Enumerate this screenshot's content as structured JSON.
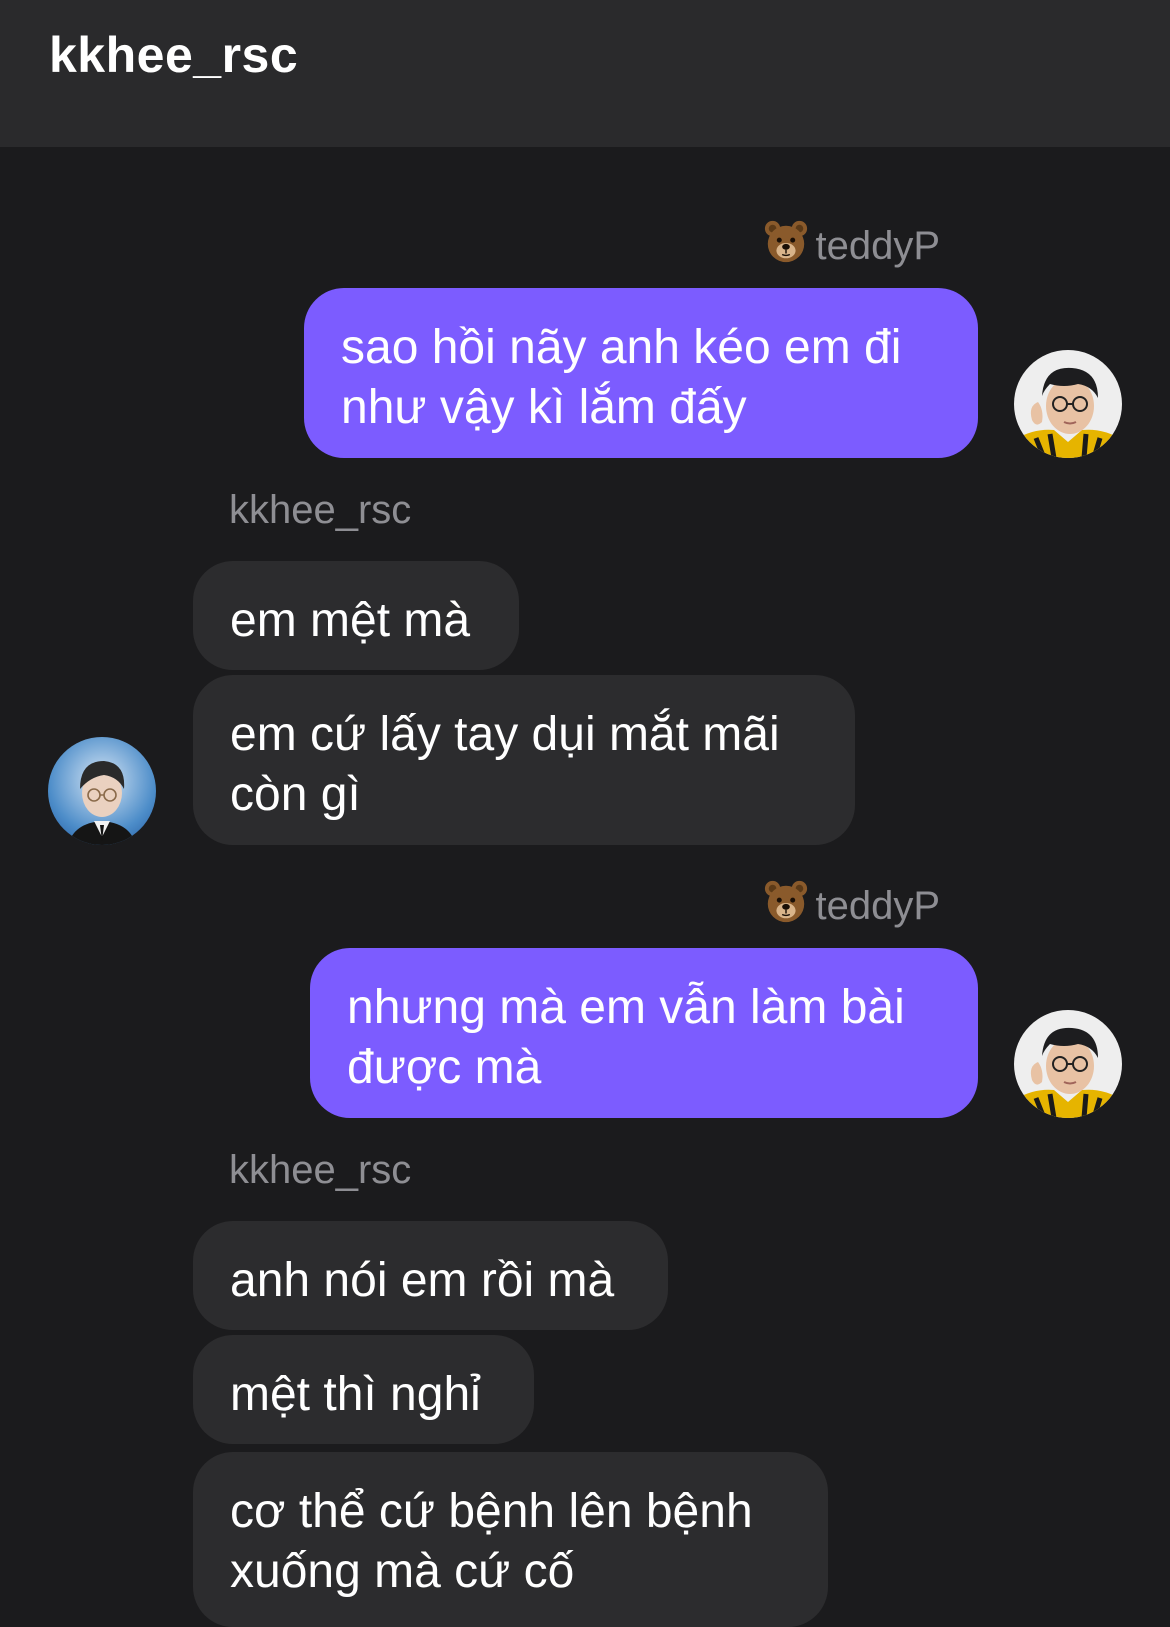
{
  "header": {
    "title": "kkhee_rsc"
  },
  "messages": [
    {
      "sender": "teddyP",
      "sender_emoji": "bear-face-icon",
      "side": "right",
      "text": "sao hồi nãy anh kéo em đi như vậy kì lắm đấy",
      "avatar": "avatar-teddyP"
    },
    {
      "sender": "kkhee_rsc",
      "side": "left",
      "texts": [
        "em mệt mà",
        "em cứ lấy tay dụi mắt mãi còn gì"
      ],
      "avatar": "avatar-kkhee_rsc"
    },
    {
      "sender": "teddyP",
      "sender_emoji": "bear-face-icon",
      "side": "right",
      "text": "nhưng mà em vẫn làm bài được mà",
      "avatar": "avatar-teddyP"
    },
    {
      "sender": "kkhee_rsc",
      "side": "left",
      "texts": [
        "anh nói em rồi mà",
        "mệt thì nghỉ",
        "cơ thể cứ bệnh lên bệnh xuống mà cứ cố"
      ]
    }
  ],
  "colors": {
    "background": "#1b1b1d",
    "header": "#2a2a2c",
    "my_bubble": "#7c5cff",
    "their_bubble": "#2c2c2e",
    "sender_label": "#8e8e93"
  }
}
